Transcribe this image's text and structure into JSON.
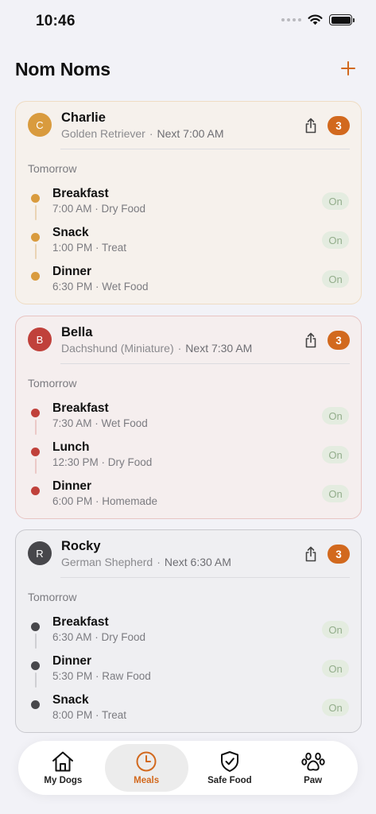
{
  "status_bar": {
    "time": "10:46"
  },
  "header": {
    "title": "Nom Noms",
    "add_icon": "plus-icon"
  },
  "dogs": [
    {
      "initial": "C",
      "name": "Charlie",
      "breed": "Golden Retriever",
      "next": "Next 7:00 AM",
      "count": "3",
      "day_label": "Tomorrow",
      "accent": "#d99b3e",
      "card_bg": "#f6f1ec",
      "border": "#efdcc3",
      "line": "#ead3b4",
      "meals": [
        {
          "name": "Breakfast",
          "detail": "7:00 AM · Dry Food",
          "toggle": "On"
        },
        {
          "name": "Snack",
          "detail": "1:00 PM · Treat",
          "toggle": "On"
        },
        {
          "name": "Dinner",
          "detail": "6:30 PM · Wet Food",
          "toggle": "On"
        }
      ]
    },
    {
      "initial": "B",
      "name": "Bella",
      "breed": "Dachshund (Miniature)",
      "next": "Next 7:30 AM",
      "count": "3",
      "day_label": "Tomorrow",
      "accent": "#c0413b",
      "card_bg": "#f5eeee",
      "border": "#e8c4c2",
      "line": "#ebc9c7",
      "meals": [
        {
          "name": "Breakfast",
          "detail": "7:30 AM · Wet Food",
          "toggle": "On"
        },
        {
          "name": "Lunch",
          "detail": "12:30 PM · Dry Food",
          "toggle": "On"
        },
        {
          "name": "Dinner",
          "detail": "6:00 PM · Homemade",
          "toggle": "On"
        }
      ]
    },
    {
      "initial": "R",
      "name": "Rocky",
      "breed": "German Shepherd",
      "next": "Next 6:30 AM",
      "count": "3",
      "day_label": "Tomorrow",
      "accent": "#47474b",
      "card_bg": "#efeff2",
      "border": "#c9c9ce",
      "line": "#cfcfd3",
      "meals": [
        {
          "name": "Breakfast",
          "detail": "6:30 AM · Dry Food",
          "toggle": "On"
        },
        {
          "name": "Dinner",
          "detail": "5:30 PM · Raw Food",
          "toggle": "On"
        },
        {
          "name": "Snack",
          "detail": "8:00 PM · Treat",
          "toggle": "On"
        }
      ]
    }
  ],
  "tab_bar": {
    "tabs": [
      {
        "label": "My Dogs",
        "icon": "house-icon"
      },
      {
        "label": "Meals",
        "icon": "clock-icon",
        "active": true
      },
      {
        "label": "Safe Food",
        "icon": "shield-check-icon"
      },
      {
        "label": "Paw",
        "icon": "paw-icon"
      }
    ]
  },
  "colors": {
    "accent": "#d2691e"
  }
}
